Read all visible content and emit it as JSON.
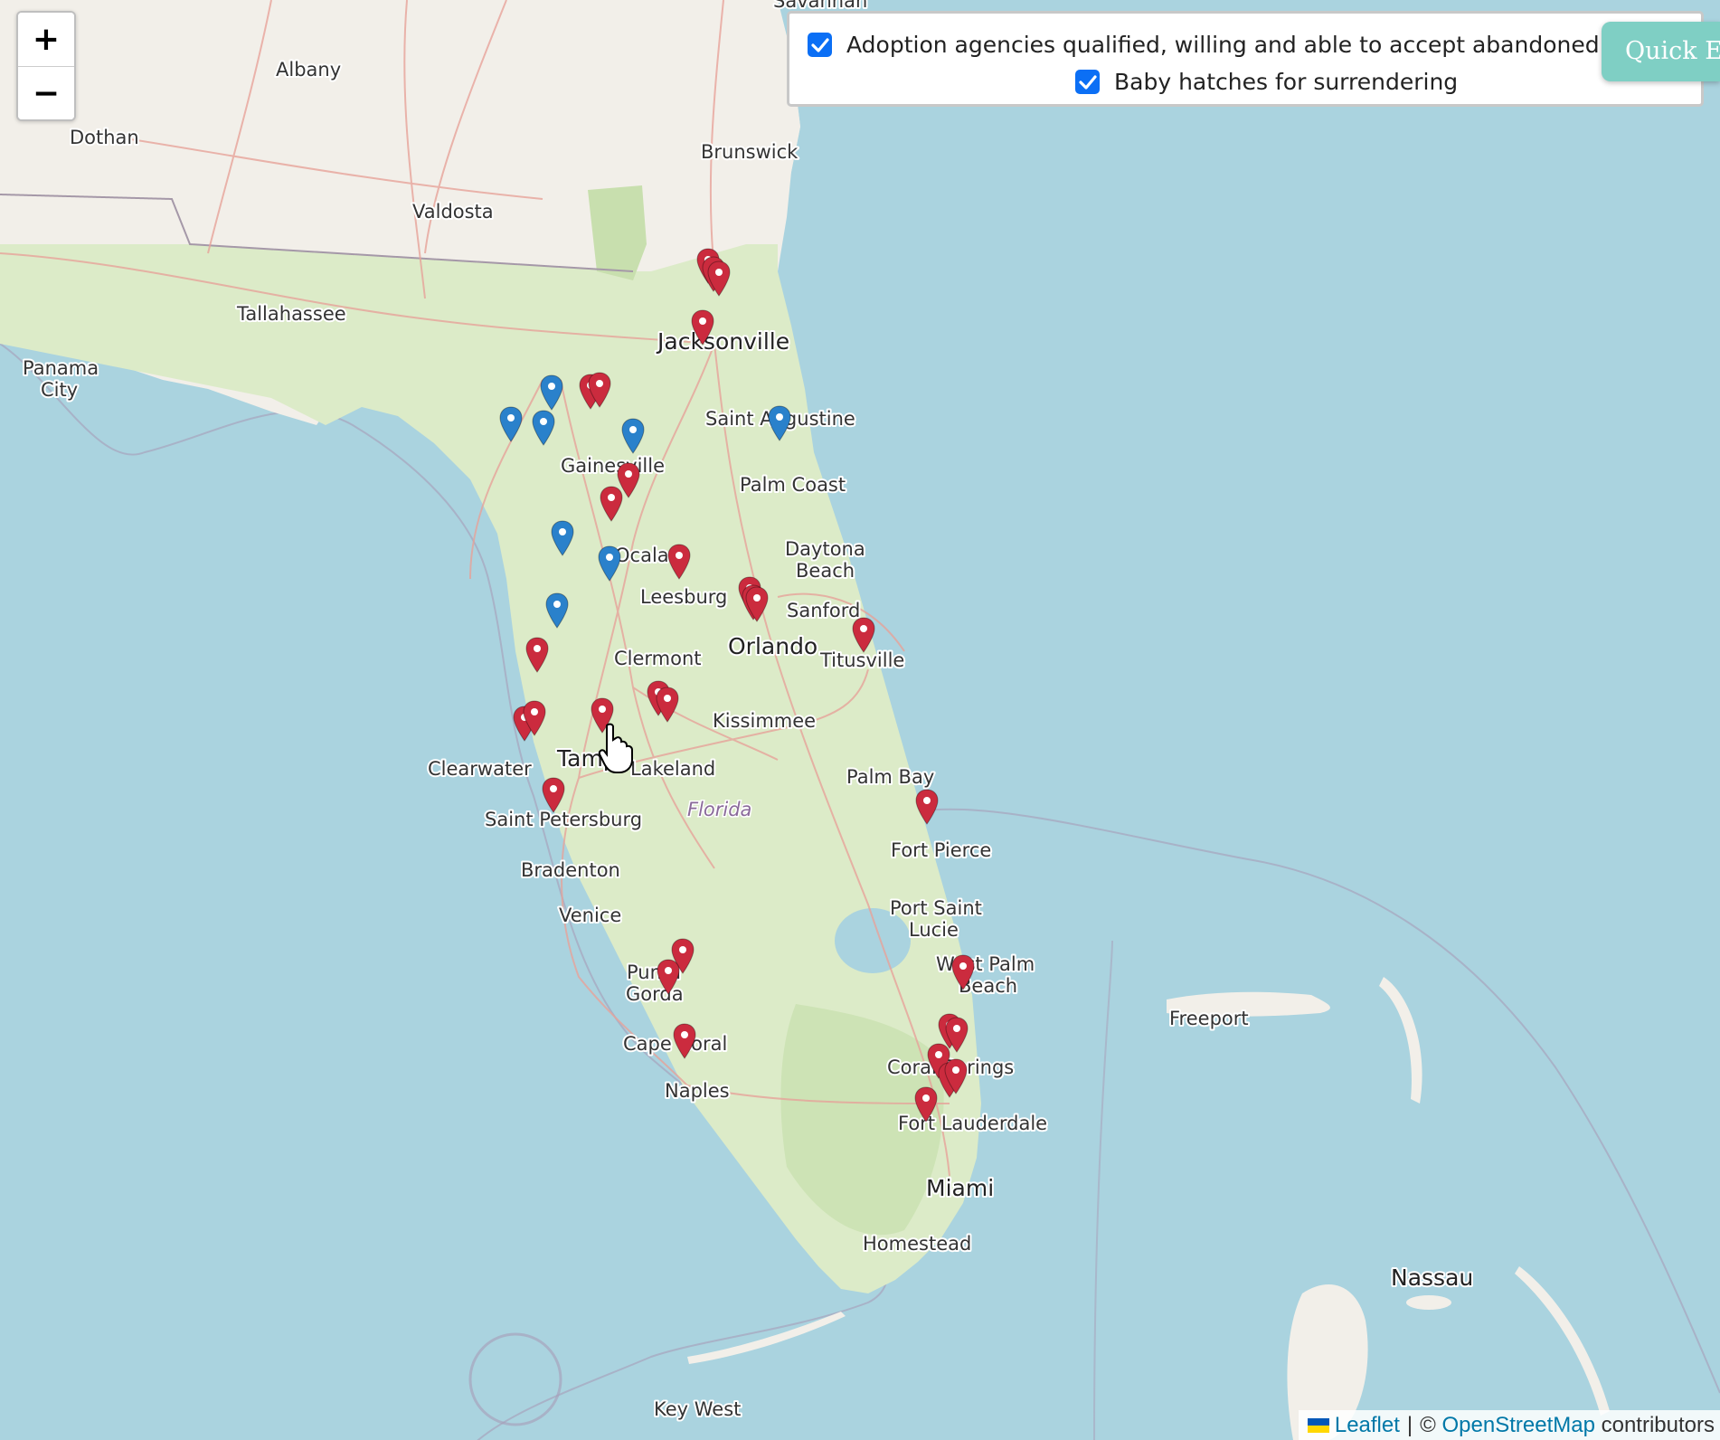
{
  "zoom": {
    "in_label": "+",
    "out_label": "−"
  },
  "filters": [
    {
      "label": "Adoption agencies qualified, willing and able to accept abandoned newborns",
      "checked": true,
      "color": "#0b6ff5"
    },
    {
      "label": "Baby hatches for surrendering",
      "checked": true,
      "color": "#0b6ff5"
    }
  ],
  "quick_exit": {
    "label": "Quick Exit"
  },
  "attribution": {
    "leaflet": "Leaflet",
    "separator": "|",
    "copyright": "©",
    "osm": "OpenStreetMap",
    "contributors": "contributors"
  },
  "map": {
    "colors": {
      "water": "#aad3df",
      "land": "#f2efe9",
      "green_land": "#dcebc8",
      "marker_red": "#cb2b3e",
      "marker_blue": "#2a81cb",
      "road": "#e7a39a",
      "state_border": "#a598a8"
    },
    "labels": {
      "savannah": "Savannah",
      "albany": "Albany",
      "dothan": "Dothan",
      "brunswick": "Brunswick",
      "valdosta": "Valdosta",
      "tallahassee": "Tallahassee",
      "panama": "Panama",
      "city": "City",
      "jacksonville": "Jacksonville",
      "saint_augustine": "Saint Augustine",
      "gainesville": "Gainesville",
      "palm_coast": "Palm Coast",
      "ocala": "Ocala",
      "daytona": "Daytona",
      "beach": "Beach",
      "leesburg": "Leesburg",
      "sanford": "Sanford",
      "orlando": "Orlando",
      "titusville": "Titusville",
      "clermont": "Clermont",
      "kissimmee": "Kissimmee",
      "tampa": "Tampa",
      "clearwater": "Clearwater",
      "lakeland": "Lakeland",
      "palm_bay": "Palm Bay",
      "florida": "Florida",
      "saint_petersburg": "Saint Petersburg",
      "fort_pierce": "Fort Pierce",
      "bradenton": "Bradenton",
      "venice": "Venice",
      "port_saint": "Port Saint",
      "lucie": "Lucie",
      "punta": "Punta",
      "gorda": "Gorda",
      "west_palm": "West Palm",
      "beach2": "Beach",
      "cape_coral": "Cape Coral",
      "coral_springs": "Coral Springs",
      "freeport": "Freeport",
      "naples": "Naples",
      "fort_lauderdale": "Fort Lauderdale",
      "miami": "Miami",
      "homestead": "Homestead",
      "nassau": "Nassau",
      "key_west": "Key West"
    }
  }
}
